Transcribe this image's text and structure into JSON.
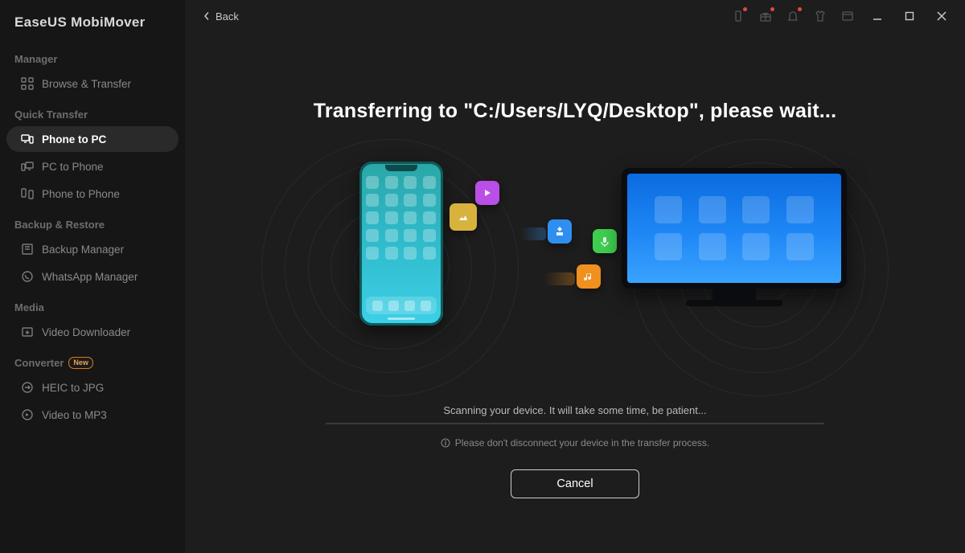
{
  "app": {
    "title": "EaseUS MobiMover"
  },
  "titlebar": {
    "back_label": "Back"
  },
  "sidebar": {
    "sections": {
      "manager": {
        "label": "Manager",
        "items": [
          {
            "label": "Browse & Transfer"
          }
        ]
      },
      "quick_transfer": {
        "label": "Quick Transfer",
        "items": [
          {
            "label": "Phone to PC"
          },
          {
            "label": "PC to Phone"
          },
          {
            "label": "Phone to Phone"
          }
        ]
      },
      "backup_restore": {
        "label": "Backup & Restore",
        "items": [
          {
            "label": "Backup Manager"
          },
          {
            "label": "WhatsApp Manager"
          }
        ]
      },
      "media": {
        "label": "Media",
        "items": [
          {
            "label": "Video Downloader"
          }
        ]
      },
      "converter": {
        "label": "Converter",
        "badge": "New",
        "items": [
          {
            "label": "HEIC to JPG"
          },
          {
            "label": "Video to MP3"
          }
        ]
      }
    }
  },
  "main": {
    "heading": "Transferring to \"C:/Users/LYQ/Desktop\", please wait...",
    "status_text": "Scanning your device. It will take some time, be patient...",
    "hint_text": "Please don't disconnect your device in the transfer process.",
    "cancel_label": "Cancel"
  }
}
